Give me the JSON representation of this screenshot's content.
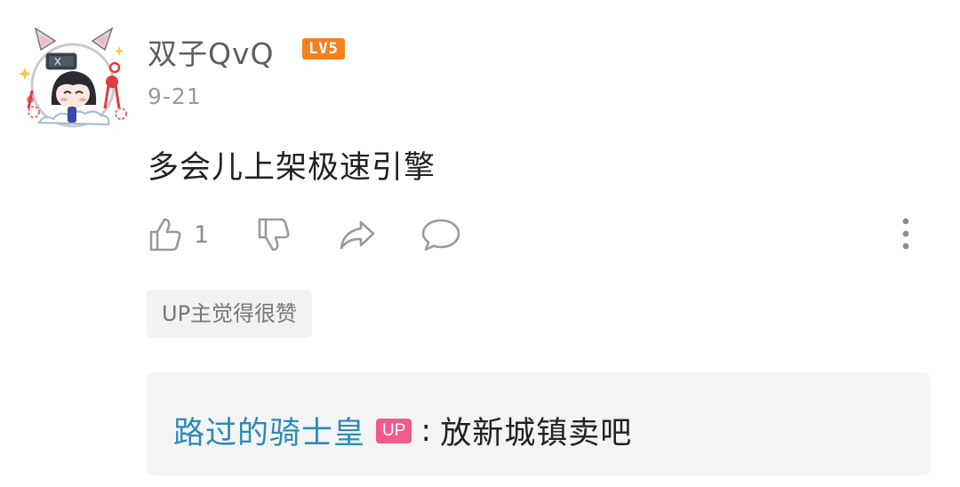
{
  "comment": {
    "username": "双子QvQ",
    "level": "LV5",
    "date": "9-21",
    "text": "多会儿上架极速引擎",
    "like_count": "1",
    "highlight_tag": "UP主觉得很赞"
  },
  "actions": {
    "like_icon": "thumbs-up-icon",
    "dislike_icon": "thumbs-down-icon",
    "share_icon": "share-arrow-icon",
    "reply_icon": "speech-bubble-icon",
    "more_icon": "vertical-ellipsis-icon"
  },
  "reply": {
    "author": "路过的骑士皇",
    "badge": "UP",
    "separator": ":",
    "text": "放新城镇卖吧"
  },
  "colors": {
    "level_badge": "#f5801e",
    "up_badge": "#f05a8c",
    "reply_author": "#2e8ab8",
    "icon_gray": "#9a9a9a"
  }
}
